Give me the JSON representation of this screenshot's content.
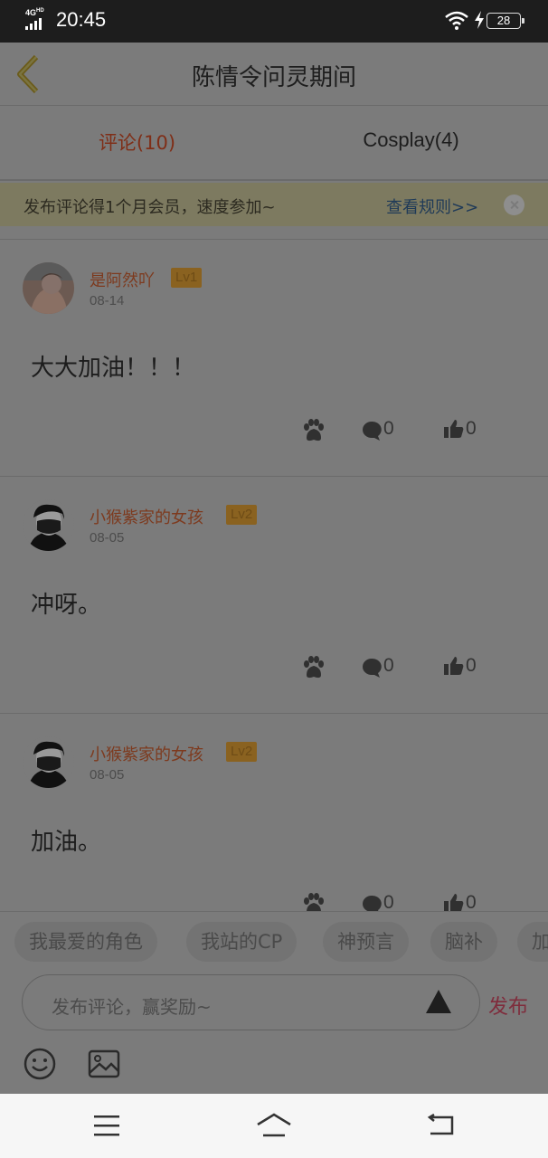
{
  "status_bar": {
    "network": "4G",
    "network_sup": "HD",
    "time": "20:45",
    "battery": "28"
  },
  "header": {
    "title": "陈情令问灵期间"
  },
  "tabs": [
    {
      "label": "评论(10)",
      "active": true
    },
    {
      "label": "Cosplay(4)",
      "active": false
    }
  ],
  "banner": {
    "text": "发布评论得1个月会员，速度参加~",
    "link": "查看规则>>"
  },
  "comments": [
    {
      "username": "是阿然吖",
      "level": "Lv1",
      "date": "08-14",
      "content": "大大加油！！！",
      "replies": "0",
      "likes": "0"
    },
    {
      "username": "小猴紫家的女孩",
      "level": "Lv2",
      "date": "08-05",
      "content": "冲呀。",
      "replies": "0",
      "likes": "0"
    },
    {
      "username": "小猴紫家的女孩",
      "level": "Lv2",
      "date": "08-05",
      "content": "加油。",
      "replies": "0",
      "likes": "0"
    }
  ],
  "tags": [
    "我最爱的角色",
    "我站的CP",
    "神预言",
    "脑补",
    "加"
  ],
  "composer": {
    "placeholder": "发布评论，赢奖励~",
    "publish": "发布"
  },
  "colors": {
    "accent": "#e8451e",
    "overlay_gray": "#7b7b7b",
    "publish": "#ff3b6b"
  }
}
